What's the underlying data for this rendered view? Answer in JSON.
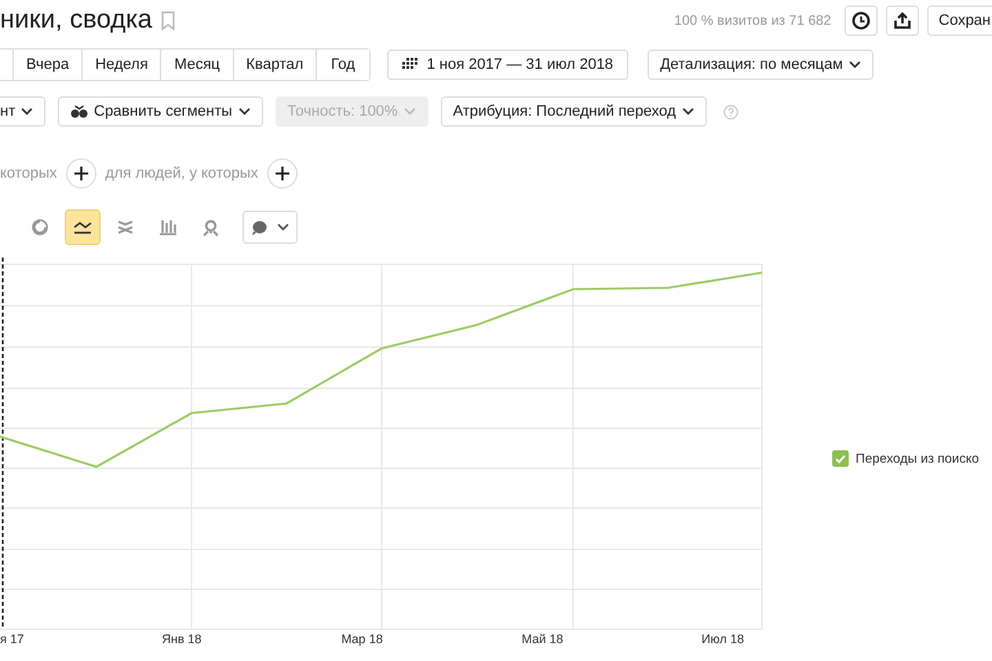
{
  "title": "ники, сводка",
  "visits_note": "100 % визитов из 71 682",
  "save_button": "Сохран",
  "periods": [
    {
      "label": "Вчера",
      "selected": false
    },
    {
      "label": "Неделя",
      "selected": false
    },
    {
      "label": "Месяц",
      "selected": false
    },
    {
      "label": "Квартал",
      "selected": false
    },
    {
      "label": "Год",
      "selected": false
    }
  ],
  "date_range": "1 ноя 2017 — 31 июл 2018",
  "detail_dropdown": "Детализация: по месяцам",
  "filters": [
    {
      "kind": "plain",
      "label": "нт",
      "disabled": false
    },
    {
      "kind": "compare",
      "label": "Сравнить сегменты",
      "disabled": false
    },
    {
      "kind": "plain",
      "label": "Точность: 100%",
      "disabled": true
    },
    {
      "kind": "plain",
      "label": "Атрибуция: Последний переход",
      "disabled": false
    }
  ],
  "segment_conditions": [
    "которых",
    "для людей, у которых"
  ],
  "chart_types": [
    {
      "kind": "pie",
      "selected": false
    },
    {
      "kind": "line",
      "selected": true
    },
    {
      "kind": "stacked",
      "selected": false
    },
    {
      "kind": "bars",
      "selected": false
    },
    {
      "kind": "map",
      "selected": false
    }
  ],
  "chart": {
    "x_labels": [
      "я 17",
      "Янв 18",
      "Мар 18",
      "Май 18",
      "Июл 18"
    ],
    "legend": [
      {
        "label": "Переходы из поиско",
        "checked": true
      }
    ]
  }
}
